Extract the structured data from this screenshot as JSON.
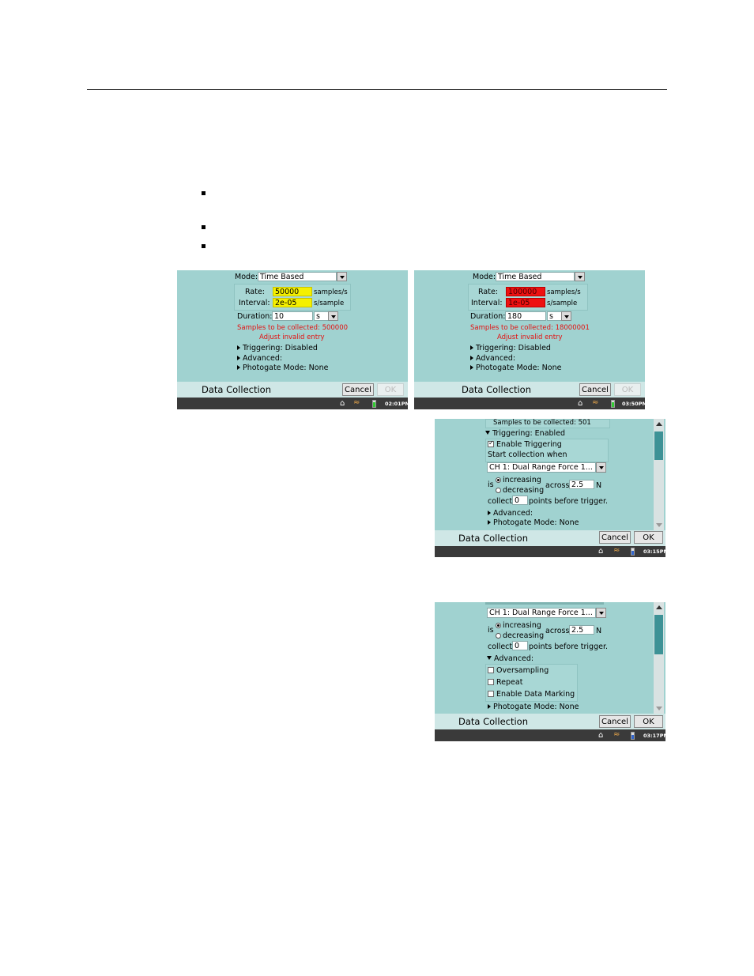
{
  "screen1": {
    "mode_label": "Mode:",
    "mode_value": "Time Based",
    "rate_label": "Rate:",
    "rate_value": "50000",
    "rate_unit": "samples/s",
    "interval_label": "Interval:",
    "interval_value": "2e-05",
    "interval_unit": "s/sample",
    "duration_label": "Duration:",
    "duration_value": "10",
    "duration_unit": "s",
    "samples_msg": "Samples to be collected: 500000",
    "adjust_msg": "Adjust invalid entry",
    "triggering": "Triggering: Disabled",
    "advanced": "Advanced:",
    "photogate": "Photogate Mode: None",
    "title": "Data Collection",
    "cancel": "Cancel",
    "ok": "OK",
    "clock": "02:01PM",
    "field_highlight_color": "#f5f000"
  },
  "screen2": {
    "mode_label": "Mode:",
    "mode_value": "Time Based",
    "rate_label": "Rate:",
    "rate_value": "100000",
    "rate_unit": "samples/s",
    "interval_label": "Interval:",
    "interval_value": "1e-05",
    "interval_unit": "s/sample",
    "duration_label": "Duration:",
    "duration_value": "180",
    "duration_unit": "s",
    "samples_msg": "Samples to be collected: 18000001",
    "adjust_msg": "Adjust invalid entry",
    "triggering": "Triggering: Disabled",
    "advanced": "Advanced:",
    "photogate": "Photogate Mode: None",
    "title": "Data Collection",
    "cancel": "Cancel",
    "ok": "OK",
    "clock": "03:50PM",
    "field_highlight_color": "#ee1111"
  },
  "screen3": {
    "samples_msg": "Samples to be collected: 501",
    "triggering": "Triggering: Enabled",
    "enable_triggering": "Enable Triggering",
    "start_when": "Start collection when",
    "channel": "CH 1: Dual Range Force 1...",
    "is_label": "is",
    "increasing": "increasing",
    "decreasing": "decreasing",
    "across_label": "across",
    "across_value": "2.5",
    "unit": "N",
    "collect_label": "collect",
    "collect_value": "0",
    "points_label": "points before trigger.",
    "advanced": "Advanced:",
    "photogate": "Photogate Mode: None",
    "title": "Data Collection",
    "cancel": "Cancel",
    "ok": "OK",
    "clock": "03:15PM"
  },
  "screen4": {
    "channel": "CH 1: Dual Range Force 1...",
    "is_label": "is",
    "increasing": "increasing",
    "decreasing": "decreasing",
    "across_label": "across",
    "across_value": "2.5",
    "unit": "N",
    "collect_label": "collect",
    "collect_value": "0",
    "points_label": "points before trigger.",
    "advanced": "Advanced:",
    "oversampling": "Oversampling",
    "repeat": "Repeat",
    "enable_data_marking": "Enable Data Marking",
    "photogate": "Photogate Mode: None",
    "title": "Data Collection",
    "cancel": "Cancel",
    "ok": "OK",
    "clock": "03:17PM"
  }
}
